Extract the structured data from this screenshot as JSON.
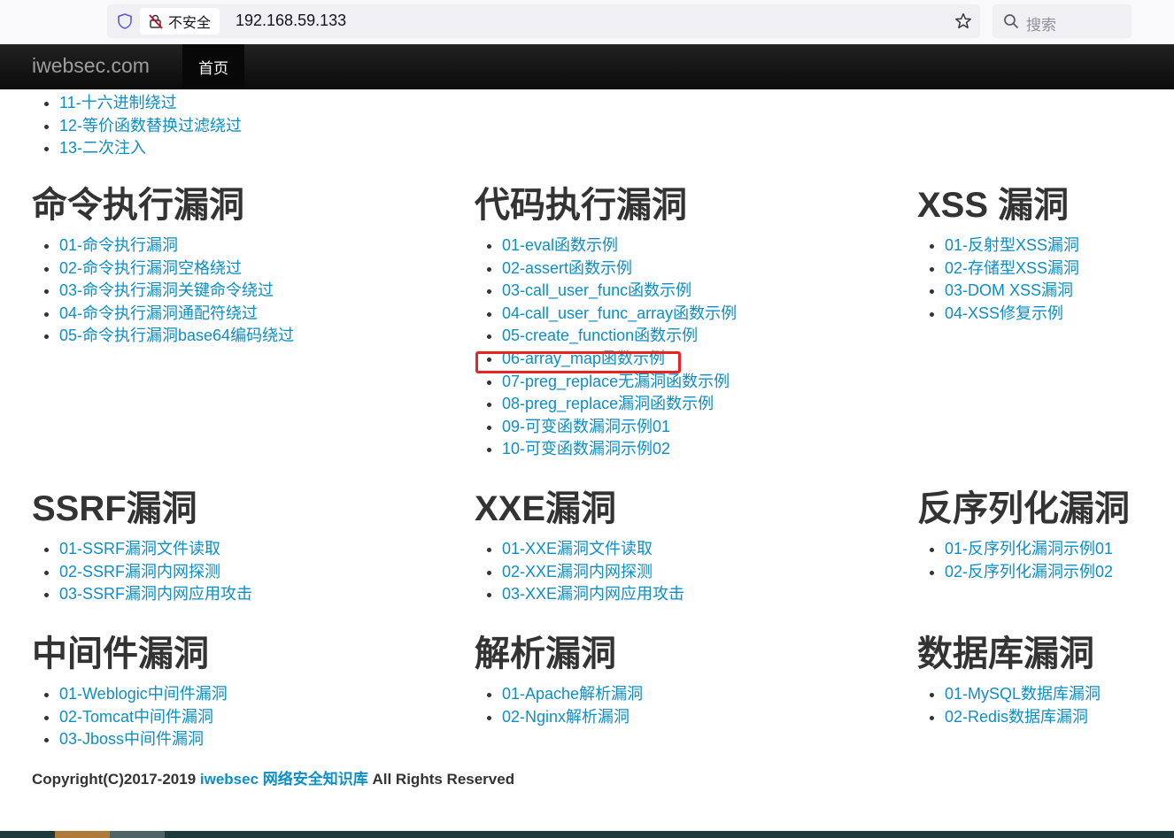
{
  "browser": {
    "security_label": "不安全",
    "url": "192.168.59.133",
    "search_placeholder": "搜索"
  },
  "nav": {
    "brand": "iwebsec.com",
    "home": "首页"
  },
  "top_list": [
    "11-十六进制绕过",
    "12-等价函数替换过滤绕过",
    "13-二次注入"
  ],
  "sections": {
    "cmd": {
      "title": "命令执行漏洞",
      "items": [
        "01-命令执行漏洞",
        "02-命令执行漏洞空格绕过",
        "03-命令执行漏洞关键命令绕过",
        "04-命令执行漏洞通配符绕过",
        "05-命令执行漏洞base64编码绕过"
      ]
    },
    "code": {
      "title": "代码执行漏洞",
      "items": [
        "01-eval函数示例",
        "02-assert函数示例",
        "03-call_user_func函数示例",
        "04-call_user_func_array函数示例",
        "05-create_function函数示例",
        "06-array_map函数示例",
        "07-preg_replace无漏洞函数示例",
        "08-preg_replace漏洞函数示例",
        "09-可变函数漏洞示例01",
        "10-可变函数漏洞示例02"
      ]
    },
    "xss": {
      "title": "XSS 漏洞",
      "items": [
        "01-反射型XSS漏洞",
        "02-存储型XSS漏洞",
        "03-DOM XSS漏洞",
        "04-XSS修复示例"
      ]
    },
    "ssrf": {
      "title": "SSRF漏洞",
      "items": [
        "01-SSRF漏洞文件读取",
        "02-SSRF漏洞内网探测",
        "03-SSRF漏洞内网应用攻击"
      ]
    },
    "xxe": {
      "title": "XXE漏洞",
      "items": [
        "01-XXE漏洞文件读取",
        "02-XXE漏洞内网探测",
        "03-XXE漏洞内网应用攻击"
      ]
    },
    "unser": {
      "title": "反序列化漏洞",
      "items": [
        "01-反序列化漏洞示例01",
        "02-反序列化漏洞示例02"
      ]
    },
    "middleware": {
      "title": "中间件漏洞",
      "items": [
        "01-Weblogic中间件漏洞",
        "02-Tomcat中间件漏洞",
        "03-Jboss中间件漏洞"
      ]
    },
    "parse": {
      "title": "解析漏洞",
      "items": [
        "01-Apache解析漏洞",
        "02-Nginx解析漏洞"
      ]
    },
    "db": {
      "title": "数据库漏洞",
      "items": [
        "01-MySQL数据库漏洞",
        "02-Redis数据库漏洞"
      ]
    }
  },
  "footer": {
    "prefix": "Copyright(C)2017-2019 ",
    "link": "iwebsec 网络安全知识库",
    "suffix": " All Rights Reserved"
  },
  "colors": {
    "link": "#0d8ec6",
    "heading": "#333333",
    "highlight": "#e8261f",
    "nav_bg": "#111111"
  }
}
